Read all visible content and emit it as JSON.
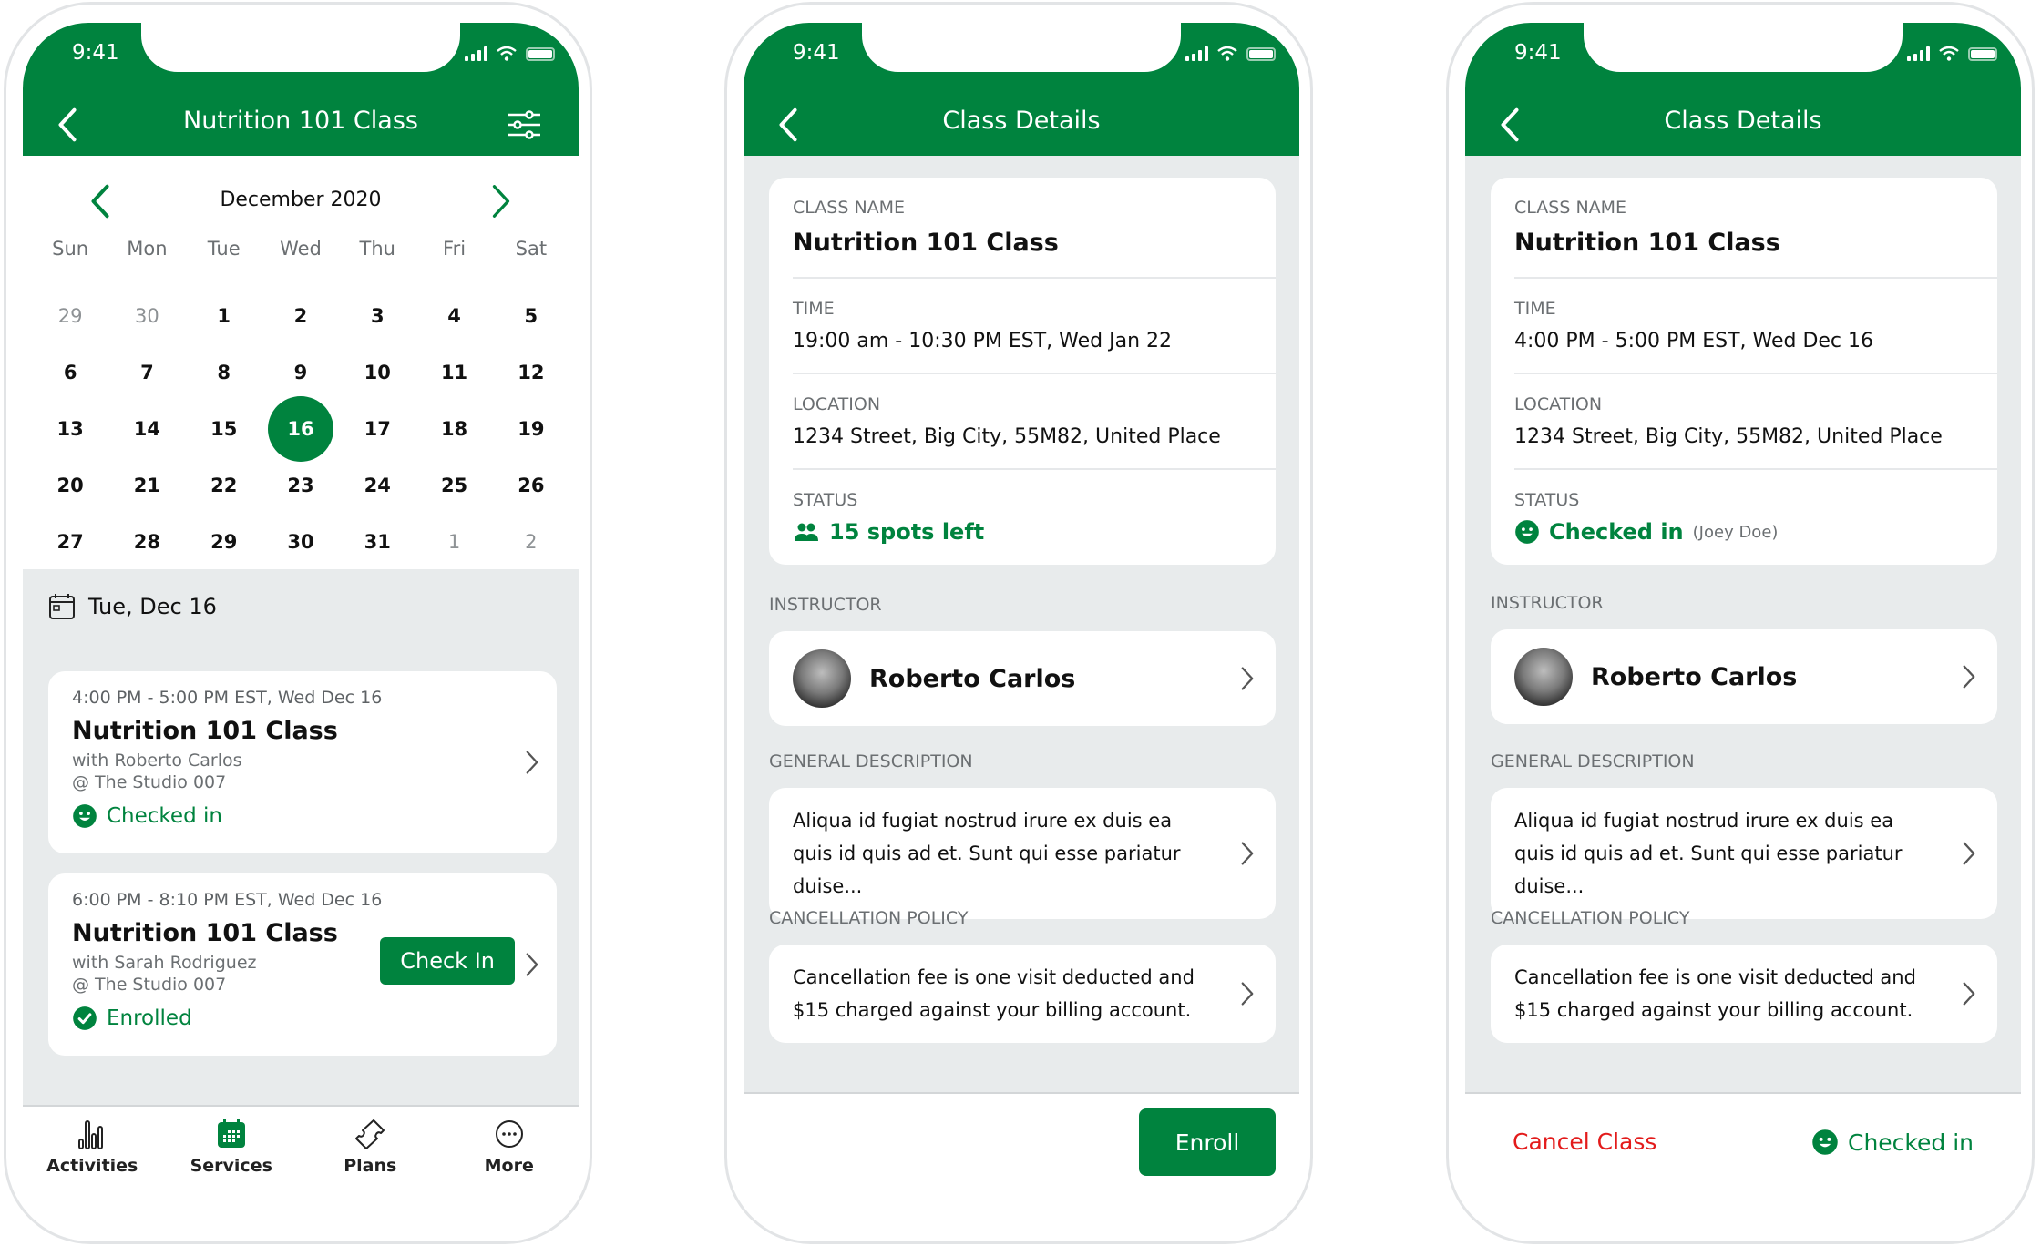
{
  "colors": {
    "brand_green": "#00833e",
    "danger_red": "#e31b1b",
    "bg_grey": "#e8ebec"
  },
  "status_bar": {
    "time": "9:41",
    "icons": [
      "signal-icon",
      "wifi-icon",
      "battery-icon"
    ]
  },
  "schedule_screen": {
    "title": "Nutrition 101 Class",
    "calendar": {
      "month_label": "December 2020",
      "weekdays": [
        "Sun",
        "Mon",
        "Tue",
        "Wed",
        "Thu",
        "Fri",
        "Sat"
      ],
      "days": [
        {
          "d": "29",
          "muted": true
        },
        {
          "d": "30",
          "muted": true
        },
        {
          "d": "1"
        },
        {
          "d": "2"
        },
        {
          "d": "3"
        },
        {
          "d": "4"
        },
        {
          "d": "5"
        },
        {
          "d": "6"
        },
        {
          "d": "7"
        },
        {
          "d": "8"
        },
        {
          "d": "9"
        },
        {
          "d": "10"
        },
        {
          "d": "11"
        },
        {
          "d": "12"
        },
        {
          "d": "13"
        },
        {
          "d": "14"
        },
        {
          "d": "15"
        },
        {
          "d": "16",
          "selected": true
        },
        {
          "d": "17"
        },
        {
          "d": "18"
        },
        {
          "d": "19"
        },
        {
          "d": "20"
        },
        {
          "d": "21"
        },
        {
          "d": "22"
        },
        {
          "d": "23"
        },
        {
          "d": "24"
        },
        {
          "d": "25"
        },
        {
          "d": "26"
        },
        {
          "d": "27"
        },
        {
          "d": "28"
        },
        {
          "d": "29"
        },
        {
          "d": "30"
        },
        {
          "d": "31"
        },
        {
          "d": "1",
          "muted": true
        },
        {
          "d": "2",
          "muted": true
        }
      ],
      "selected_day": "16"
    },
    "day_label": "Tue, Dec 16",
    "classes": [
      {
        "time": "4:00 PM - 5:00 PM EST, Wed Dec 16",
        "title": "Nutrition 101 Class",
        "instructor": "with Roberto Carlos",
        "location": "@ The Studio 007",
        "status": "Checked in",
        "status_icon": "smile-icon"
      },
      {
        "time": "6:00 PM - 8:10 PM EST, Wed Dec 16",
        "title": "Nutrition 101 Class",
        "instructor": "with Sarah Rodriguez",
        "location": "@ The Studio 007",
        "status": "Enrolled",
        "status_icon": "check-circle-icon",
        "action": "Check In"
      }
    ],
    "tabs": [
      {
        "label": "Activities",
        "icon": "bar-chart-icon",
        "active": false
      },
      {
        "label": "Services",
        "icon": "calendar-icon",
        "active": true
      },
      {
        "label": "Plans",
        "icon": "ticket-icon",
        "active": false
      },
      {
        "label": "More",
        "icon": "more-icon",
        "active": false
      }
    ]
  },
  "details_enroll": {
    "title": "Class Details",
    "class_name_label": "CLASS NAME",
    "class_name": "Nutrition 101 Class",
    "time_label": "TIME",
    "time": "19:00 am - 10:30 PM EST, Wed Jan 22",
    "location_label": "LOCATION",
    "location": "1234 Street, Big City, 55M82, United Place",
    "status_label": "STATUS",
    "status": "15 spots left",
    "instructor_label": "INSTRUCTOR",
    "instructor": "Roberto Carlos",
    "description_label": "GENERAL DESCRIPTION",
    "description": "Aliqua id fugiat nostrud irure ex duis ea quis id quis ad et. Sunt qui esse pariatur duise...",
    "policy_label": "CANCELLATION POLICY",
    "policy": "Cancellation fee is one visit deducted and $15 charged against your billing account.",
    "enroll_button": "Enroll"
  },
  "details_checked": {
    "title": "Class Details",
    "class_name_label": "CLASS NAME",
    "class_name": "Nutrition 101 Class",
    "time_label": "TIME",
    "time": "4:00 PM - 5:00 PM EST, Wed Dec 16",
    "location_label": "LOCATION",
    "location": "1234 Street, Big City, 55M82, United Place",
    "status_label": "STATUS",
    "status": "Checked in",
    "status_extra": "(Joey Doe)",
    "instructor_label": "INSTRUCTOR",
    "instructor": "Roberto Carlos",
    "description_label": "GENERAL DESCRIPTION",
    "description": "Aliqua id fugiat nostrud irure ex duis ea quis id quis ad et. Sunt qui esse pariatur duise...",
    "policy_label": "CANCELLATION POLICY",
    "policy": "Cancellation fee is one visit deducted and $15 charged against your billing account.",
    "cancel_button": "Cancel Class",
    "checked_in_label": "Checked in"
  }
}
